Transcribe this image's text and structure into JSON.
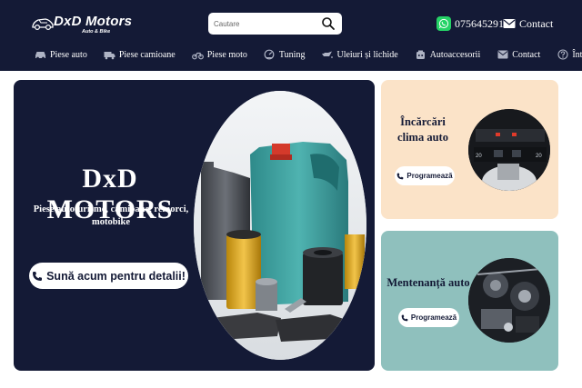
{
  "brand": {
    "name": "DxD Motors",
    "tagline": "Auto & Bike"
  },
  "search": {
    "placeholder": "Cautare"
  },
  "header": {
    "phone": "0756452917",
    "contact_label": "Contact"
  },
  "nav": [
    {
      "label": "Piese auto",
      "icon": "car-icon"
    },
    {
      "label": "Piese camioane",
      "icon": "truck-icon"
    },
    {
      "label": "Piese moto",
      "icon": "motorcycle-icon"
    },
    {
      "label": "Tuning",
      "icon": "tuning-icon"
    },
    {
      "label": "Uleiuri și lichide",
      "icon": "oil-can-icon"
    },
    {
      "label": "Autoaccesorii",
      "icon": "accessories-icon"
    },
    {
      "label": "Contact",
      "icon": "envelope-icon"
    },
    {
      "label": "Întrebări",
      "icon": "question-icon"
    }
  ],
  "hero": {
    "title": "DxD MOTORS",
    "subtitle": "Piese autoturisme, camioane, remorci, motobike",
    "cta": "Sună acum pentru detalii!"
  },
  "cards": [
    {
      "title": "Încărcări clima auto",
      "button": "Programează",
      "image": "car-climate-panel"
    },
    {
      "title": "Mentenanță auto",
      "button": "Programează",
      "image": "car-engine"
    }
  ],
  "colors": {
    "navy": "#141a36",
    "peach": "#fbe3c8",
    "teal": "#8fc0bd",
    "whatsapp": "#25d366"
  }
}
